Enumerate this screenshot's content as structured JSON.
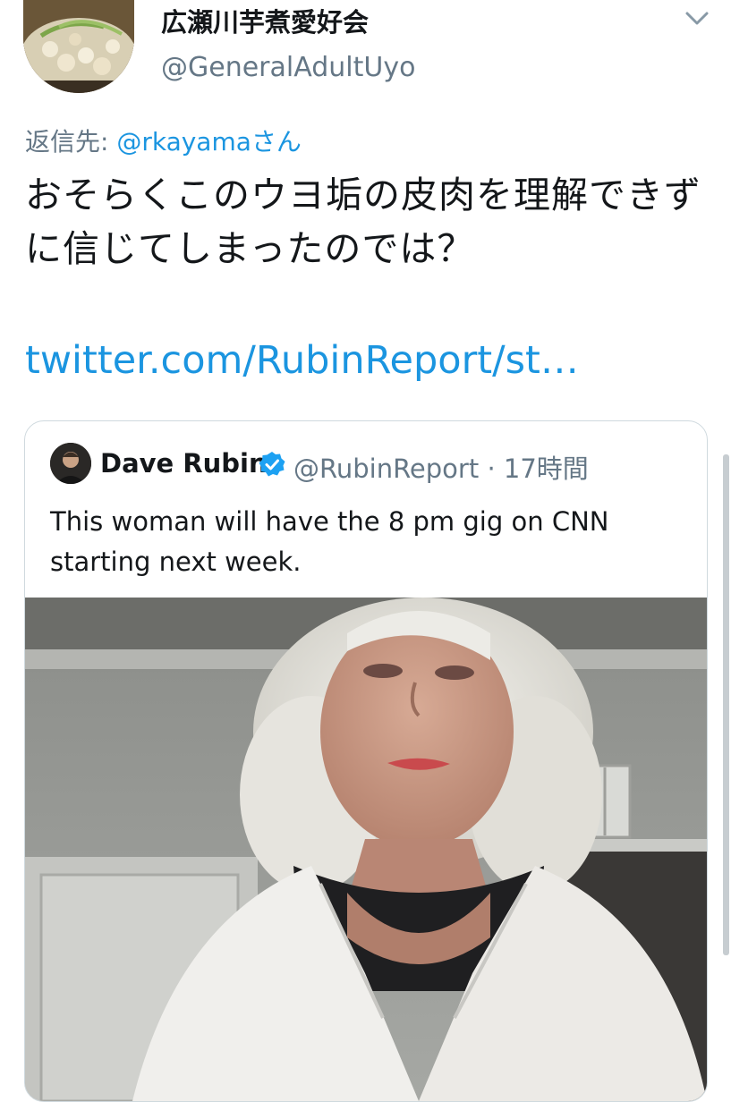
{
  "author": {
    "display_name": "広瀬川芋煮愛好会",
    "handle": "@GeneralAdultUyo",
    "avatar_icon": "food-pot-avatar"
  },
  "menu_icon": "chevron-down-icon",
  "reply": {
    "prefix": "返信先: ",
    "mention": "@rkayama",
    "suffix": "さん"
  },
  "tweet": {
    "text": "おそらくこのウヨ垢の皮肉を理解できずに信じてしまったのでは？",
    "link": "twitter.com/RubinReport/st…"
  },
  "quoted_tweet": {
    "name": "Dave Rubin",
    "verified_icon": "verified-badge-icon",
    "handle": "@RubinReport",
    "time": "· 17時間",
    "text": "This woman will have the 8 pm gig on CNN starting next week.",
    "media_alt": "video-still-woman-white-hair"
  },
  "colors": {
    "link_blue": "#1b95e0",
    "secondary_gray": "#657786",
    "text": "#14171a",
    "border": "#cfd9de"
  }
}
